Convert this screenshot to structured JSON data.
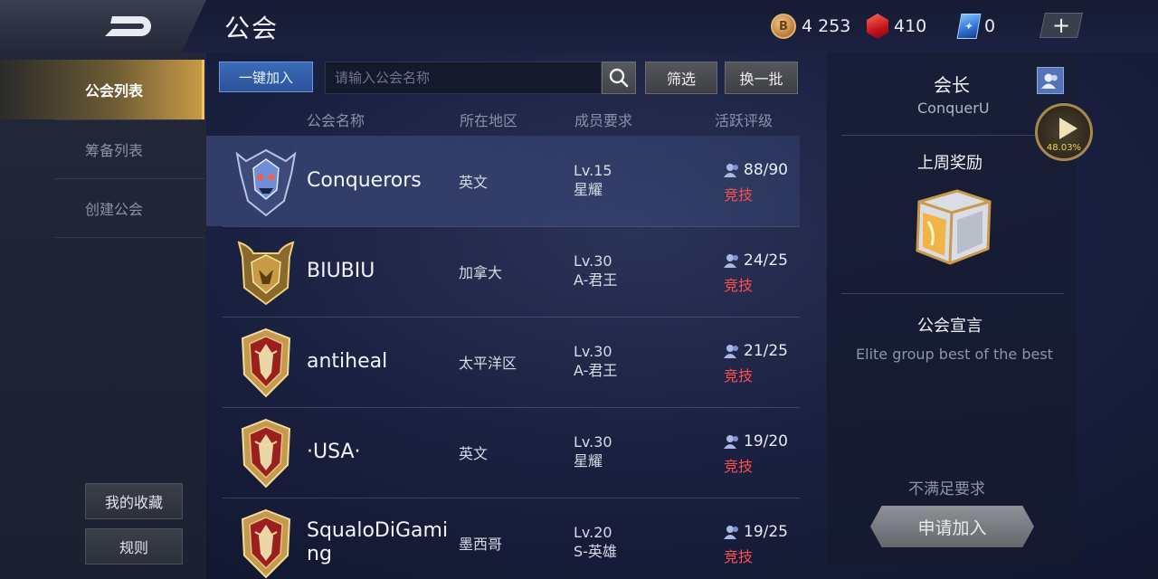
{
  "header": {
    "title": "公会",
    "currencies": [
      {
        "name": "coin",
        "value": "4 253"
      },
      {
        "name": "gem",
        "value": "410"
      },
      {
        "name": "voucher",
        "value": "0"
      }
    ],
    "plus_label": "+"
  },
  "sidebar": {
    "items": [
      {
        "label": "公会列表",
        "active": true
      },
      {
        "label": "筹备列表",
        "active": false
      },
      {
        "label": "创建公会",
        "active": false
      }
    ],
    "favorites_label": "我的收藏",
    "rules_label": "规则"
  },
  "toolbar": {
    "quick_join_label": "一键加入",
    "search_placeholder": "请输入公会名称",
    "filter_label": "筛选",
    "refresh_label": "换一批"
  },
  "table": {
    "headers": [
      "公会名称",
      "所在地区",
      "成员要求",
      "活跃评级"
    ],
    "rows": [
      {
        "name": "Conquerors",
        "region": "英文",
        "level": "Lv.15",
        "rank": "星耀",
        "members": "88/90",
        "type": "竞技",
        "emblem": "dragon-skull-emblem"
      },
      {
        "name": "BIUBIU",
        "region": "加拿大",
        "level": "Lv.30",
        "rank": "A-君王",
        "members": "24/25",
        "type": "竞技",
        "emblem": "gold-horned-emblem"
      },
      {
        "name": "antiheal",
        "region": "太平洋区",
        "level": "Lv.30",
        "rank": "A-君王",
        "members": "21/25",
        "type": "竞技",
        "emblem": "red-shield-emblem"
      },
      {
        "name": "·USA·",
        "region": "英文",
        "level": "Lv.30",
        "rank": "星耀",
        "members": "19/20",
        "type": "竞技",
        "emblem": "red-shield-emblem"
      },
      {
        "name": "SqualoDiGaming",
        "name_line1": "SqualoDiGami",
        "name_line2": "ng",
        "region": "墨西哥",
        "level": "Lv.20",
        "rank": "S-英雄",
        "members": "19/25",
        "type": "竞技",
        "emblem": "red-shield-emblem"
      }
    ]
  },
  "detail": {
    "leader_label": "会长",
    "leader_name": "ConquerU",
    "reward_label": "上周奖励",
    "declaration_label": "公会宣言",
    "declaration": "Elite group best of the best",
    "requirement_status": "不满足要求",
    "apply_label": "申请加入"
  },
  "overlay": {
    "progress": "48.03%"
  },
  "colors": {
    "accent_gold": "#f0c36b",
    "join_blue": "#3b6bb8",
    "type_red": "#ff4d4d"
  }
}
